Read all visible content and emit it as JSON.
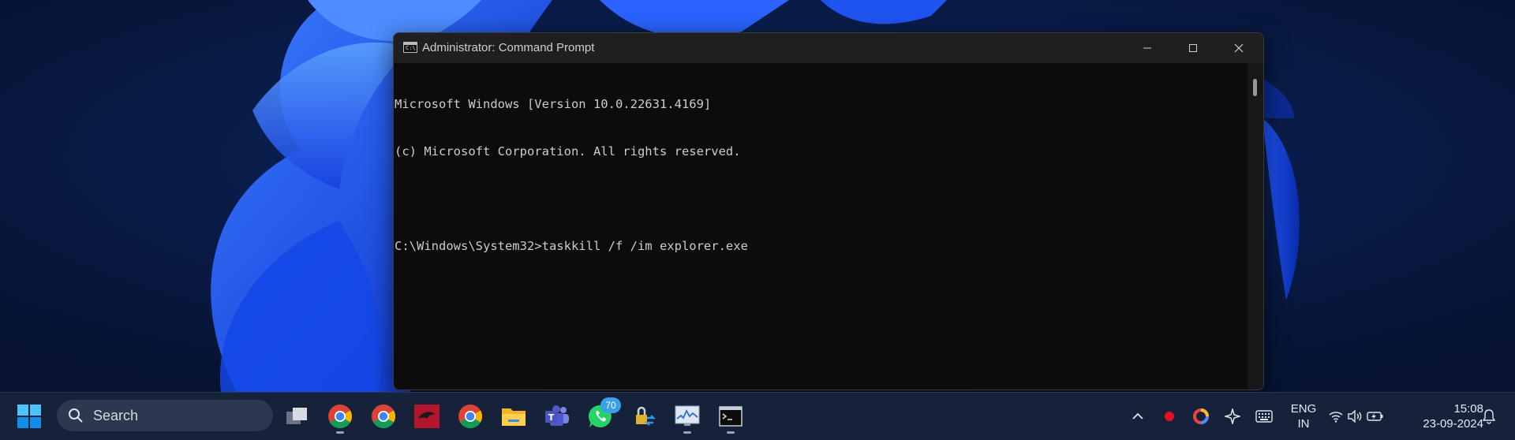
{
  "window": {
    "title": "Administrator: Command Prompt"
  },
  "console": {
    "lines": [
      "Microsoft Windows [Version 10.0.22631.4169]",
      "(c) Microsoft Corporation. All rights reserved.",
      "",
      "C:\\Windows\\System32>taskkill /f /im explorer.exe"
    ]
  },
  "taskbar": {
    "search_placeholder": "Search",
    "apps": [
      {
        "name": "task-view-icon"
      },
      {
        "name": "chrome-icon"
      },
      {
        "name": "chrome-icon"
      },
      {
        "name": "kali-icon"
      },
      {
        "name": "chrome-icon"
      },
      {
        "name": "file-explorer-icon"
      },
      {
        "name": "teams-icon"
      },
      {
        "name": "whatsapp-icon",
        "badge": "70"
      },
      {
        "name": "lock-transfer-icon"
      },
      {
        "name": "resource-monitor-icon"
      },
      {
        "name": "command-prompt-icon"
      }
    ],
    "language_line1": "ENG",
    "language_line2": "IN",
    "time": "15:08",
    "date": "23-09-2024"
  },
  "colors": {
    "accent": "#0078d4",
    "taskbar": "#16213a",
    "console_bg": "#0c0c0c",
    "console_text": "#cccccc",
    "record_dot": "#e81123"
  }
}
